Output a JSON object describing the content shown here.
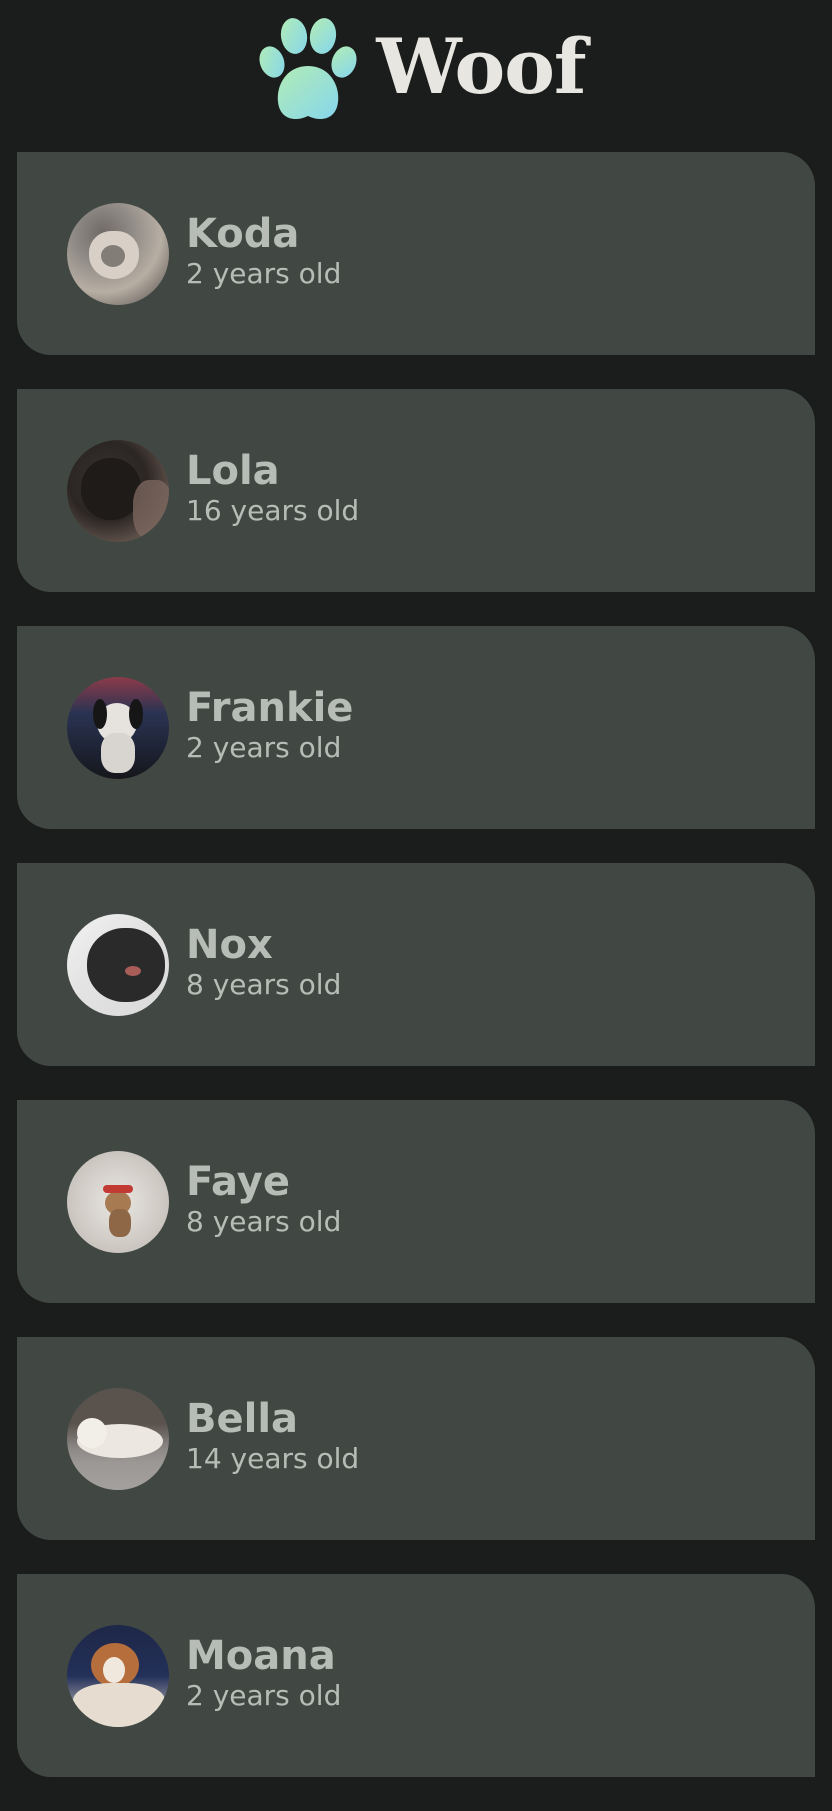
{
  "header": {
    "title": "Woof",
    "logo_icon": "paw-icon",
    "logo_gradient": [
      "#a8e6b8",
      "#8ad8e8"
    ]
  },
  "dogs": [
    {
      "name": "Koda",
      "age": "2 years old",
      "avatar_colors": [
        "#8f8a85",
        "#d8d0c6",
        "#4b4643"
      ]
    },
    {
      "name": "Lola",
      "age": "16 years old",
      "avatar_colors": [
        "#2b2624",
        "#6b5a52",
        "#141211"
      ]
    },
    {
      "name": "Frankie",
      "age": "2 years old",
      "avatar_colors": [
        "#2a3352",
        "#e6e3df",
        "#16161b"
      ]
    },
    {
      "name": "Nox",
      "age": "8 years old",
      "avatar_colors": [
        "#f2f2f2",
        "#2a2a2a",
        "#161616"
      ]
    },
    {
      "name": "Faye",
      "age": "8 years old",
      "avatar_colors": [
        "#cfcac4",
        "#a77a52",
        "#e9e6e1"
      ]
    },
    {
      "name": "Bella",
      "age": "14 years old",
      "avatar_colors": [
        "#5a534d",
        "#ece7e0",
        "#8d8a88"
      ]
    },
    {
      "name": "Moana",
      "age": "2 years old",
      "avatar_colors": [
        "#1e2747",
        "#b56e3c",
        "#e6ddd0"
      ]
    }
  ],
  "colors": {
    "background": "#1b1d1c",
    "card": "#414843",
    "text": "#b7bdb6",
    "title": "#e8e6e1"
  }
}
